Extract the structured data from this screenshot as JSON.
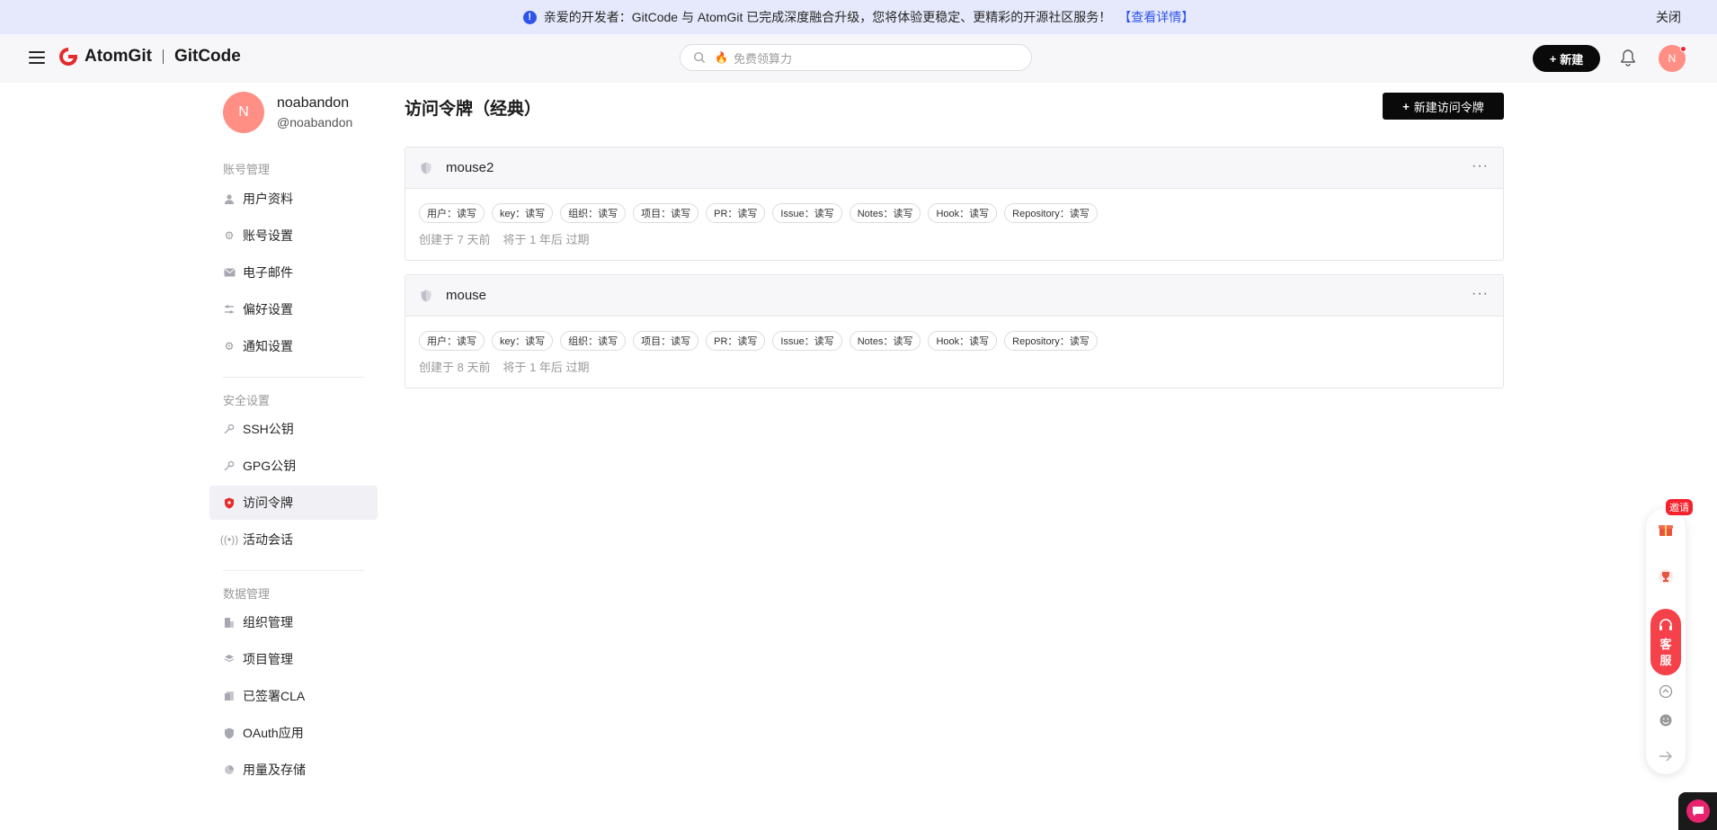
{
  "banner": {
    "text": "亲爱的开发者：GitCode 与 AtomGit 已完成深度融合升级，您将体验更稳定、更精彩的开源社区服务！",
    "link": "【查看详情】",
    "close": "关闭"
  },
  "header": {
    "logo_left": "AtomGit",
    "logo_right": "GitCode",
    "search_placeholder": "免费领算力",
    "new_button": "新建",
    "avatar_initial": "N"
  },
  "profile": {
    "initial": "N",
    "name": "noabandon",
    "handle": "@noabandon"
  },
  "sidebar": {
    "groups": [
      {
        "title": "账号管理",
        "items": [
          {
            "label": "用户资料",
            "icon": "user-icon"
          },
          {
            "label": "账号设置",
            "icon": "gear-icon"
          },
          {
            "label": "电子邮件",
            "icon": "mail-icon"
          },
          {
            "label": "偏好设置",
            "icon": "sliders-icon"
          },
          {
            "label": "通知设置",
            "icon": "notification-gear-icon"
          }
        ]
      },
      {
        "title": "安全设置",
        "items": [
          {
            "label": "SSH公钥",
            "icon": "key-icon"
          },
          {
            "label": "GPG公钥",
            "icon": "key-icon"
          },
          {
            "label": "访问令牌",
            "icon": "shield-icon",
            "active": true
          },
          {
            "label": "活动会话",
            "icon": "broadcast-icon"
          }
        ]
      },
      {
        "title": "数据管理",
        "items": [
          {
            "label": "组织管理",
            "icon": "building-icon"
          },
          {
            "label": "项目管理",
            "icon": "layers-icon"
          },
          {
            "label": "已签署CLA",
            "icon": "document-icon"
          },
          {
            "label": "OAuth应用",
            "icon": "shield-icon"
          },
          {
            "label": "用量及存储",
            "icon": "pie-chart-icon"
          }
        ]
      }
    ]
  },
  "main": {
    "title": "访问令牌（经典）",
    "create_button": "新建访问令牌",
    "tokens": [
      {
        "name": "mouse2",
        "scopes": [
          "用户：读写",
          "key：读写",
          "组织：读写",
          "项目：读写",
          "PR：读写",
          "Issue：读写",
          "Notes：读写",
          "Hook：读写",
          "Repository：读写"
        ],
        "created": "创建于 7 天前",
        "expires": "将于 1 年后 过期"
      },
      {
        "name": "mouse",
        "scopes": [
          "用户：读写",
          "key：读写",
          "组织：读写",
          "项目：读写",
          "PR：读写",
          "Issue：读写",
          "Notes：读写",
          "Hook：读写",
          "Repository：读写"
        ],
        "created": "创建于 8 天前",
        "expires": "将于 1 年后 过期"
      }
    ]
  },
  "float": {
    "invite": "邀请",
    "service_line1": "客",
    "service_line2": "服"
  },
  "colors": {
    "accent_red": "#e52c2c",
    "avatar_bg": "#ff8f85",
    "banner_bg": "#e5e9fb",
    "link_blue": "#2f54eb"
  }
}
